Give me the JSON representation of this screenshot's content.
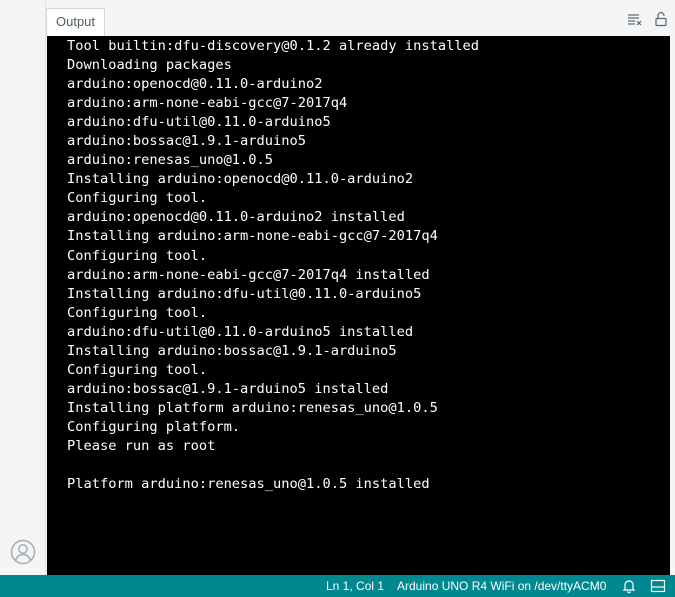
{
  "panel": {
    "tab_label": "Output",
    "actions": {
      "clear_icon": "clear-output-icon",
      "lock_icon": "lock-icon"
    }
  },
  "console": {
    "lines": [
      "Tool builtin:dfu-discovery@0.1.2 already installed",
      "Downloading packages",
      "arduino:openocd@0.11.0-arduino2",
      "arduino:arm-none-eabi-gcc@7-2017q4",
      "arduino:dfu-util@0.11.0-arduino5",
      "arduino:bossac@1.9.1-arduino5",
      "arduino:renesas_uno@1.0.5",
      "Installing arduino:openocd@0.11.0-arduino2",
      "Configuring tool.",
      "arduino:openocd@0.11.0-arduino2 installed",
      "Installing arduino:arm-none-eabi-gcc@7-2017q4",
      "Configuring tool.",
      "arduino:arm-none-eabi-gcc@7-2017q4 installed",
      "Installing arduino:dfu-util@0.11.0-arduino5",
      "Configuring tool.",
      "arduino:dfu-util@0.11.0-arduino5 installed",
      "Installing arduino:bossac@1.9.1-arduino5",
      "Configuring tool.",
      "arduino:bossac@1.9.1-arduino5 installed",
      "Installing platform arduino:renesas_uno@1.0.5",
      "Configuring platform.",
      "Please run as root",
      "",
      "Platform arduino:renesas_uno@1.0.5 installed"
    ]
  },
  "status_bar": {
    "cursor_position": "Ln 1, Col 1",
    "board_port": "Arduino UNO R4 WiFi on /dev/ttyACM0",
    "notification_icon": "bell-icon",
    "layout_icon": "panel-layout-icon"
  },
  "activity_bar": {
    "account_icon": "account-icon"
  },
  "colors": {
    "status_bar_bg": "#00878f",
    "console_bg": "#000000",
    "console_fg": "#ffffff",
    "chrome_bg": "#f4f5f6"
  }
}
